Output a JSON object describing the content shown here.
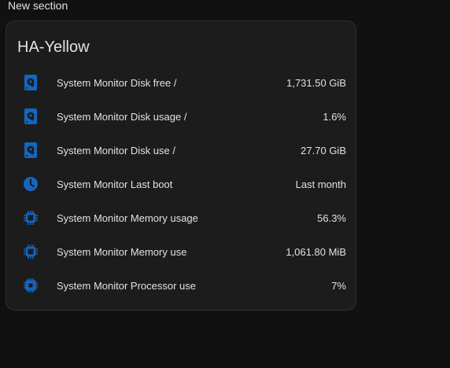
{
  "section": {
    "title": "New section"
  },
  "card": {
    "title": "HA-Yellow",
    "accent": "#1565c0",
    "entities": [
      {
        "icon": "harddisk-icon",
        "name": "System Monitor Disk free /",
        "value": "1,731.50 GiB"
      },
      {
        "icon": "harddisk-icon",
        "name": "System Monitor Disk usage /",
        "value": "1.6%"
      },
      {
        "icon": "harddisk-icon",
        "name": "System Monitor Disk use /",
        "value": "27.70 GiB"
      },
      {
        "icon": "clock-icon",
        "name": "System Monitor Last boot",
        "value": "Last month"
      },
      {
        "icon": "memory-chip-icon",
        "name": "System Monitor Memory usage",
        "value": "56.3%"
      },
      {
        "icon": "memory-chip-icon",
        "name": "System Monitor Memory use",
        "value": "1,061.80 MiB"
      },
      {
        "icon": "cpu-chip-icon",
        "name": "System Monitor Processor use",
        "value": "7%"
      }
    ]
  }
}
